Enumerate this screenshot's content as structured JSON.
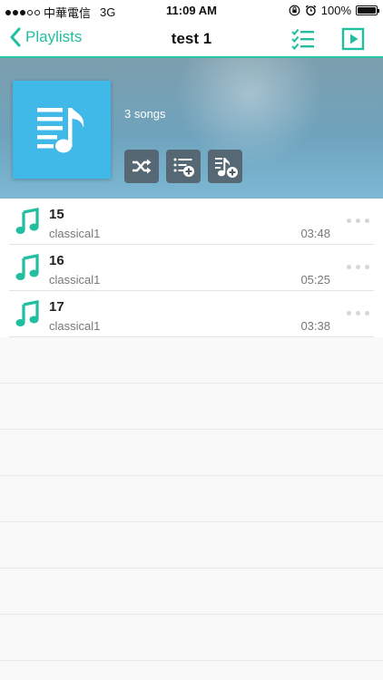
{
  "status": {
    "carrier": "中華電信",
    "network": "3G",
    "time": "11:09 AM",
    "battery": "100%"
  },
  "nav": {
    "back_label": "Playlists",
    "title": "test 1"
  },
  "header": {
    "song_count": "3 songs"
  },
  "songs": [
    {
      "title": "15",
      "artist": "classical1",
      "duration": "03:48"
    },
    {
      "title": "16",
      "artist": "classical1",
      "duration": "05:25"
    },
    {
      "title": "17",
      "artist": "classical1",
      "duration": "03:38"
    }
  ],
  "colors": {
    "accent": "#21bfa0",
    "cover": "#40b9e8"
  }
}
